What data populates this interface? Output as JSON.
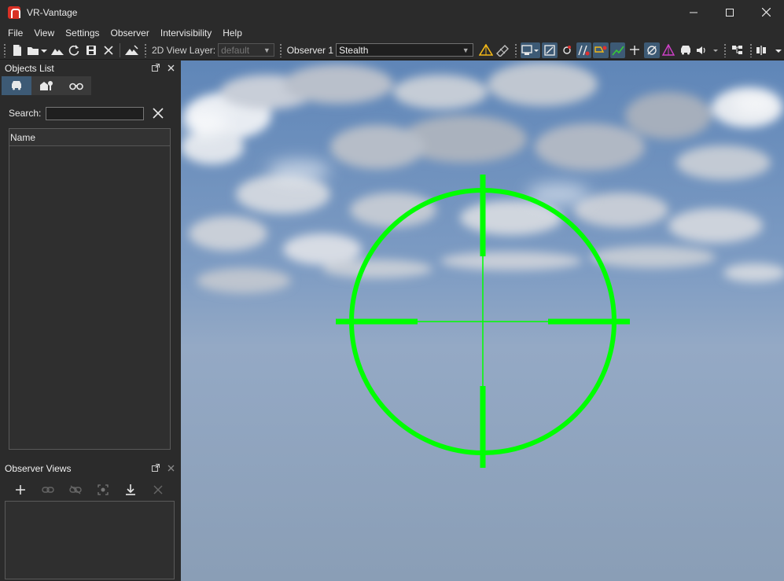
{
  "window": {
    "title": "VR-Vantage"
  },
  "menu": [
    "File",
    "View",
    "Settings",
    "Observer",
    "Intervisibility",
    "Help"
  ],
  "toolbar": {
    "view_layer_label": "2D View Layer:",
    "view_layer_value": "default",
    "observer_label": "Observer 1",
    "observer_value": "Stealth",
    "icons_file": [
      "new-file-icon",
      "open-folder-icon",
      "terrain-icon",
      "reload-icon",
      "save-icon",
      "close-icon",
      "terrain-edit-icon"
    ],
    "icons_view": [
      "measure-icon",
      "ruler-icon",
      "display-mode-icon",
      "extent-icon",
      "target-icon",
      "los-icon",
      "line-icon",
      "path-icon",
      "waypoint-icon",
      "visibility-icon",
      "cone-icon",
      "vehicle-icon",
      "sound-icon",
      "hierarchy-icon",
      "align-icon"
    ]
  },
  "objects_panel": {
    "title": "Objects List",
    "tabs": [
      "vehicle-tab-icon",
      "structures-tab-icon",
      "binoculars-tab-icon"
    ],
    "search_label": "Search:",
    "search_value": "",
    "column_name": "Name"
  },
  "observer_panel": {
    "title": "Observer Views",
    "tools": [
      "add-icon",
      "link-icon",
      "unlink-icon",
      "capture-icon",
      "download-icon",
      "delete-icon"
    ]
  },
  "colors": {
    "reticle": "#00ff00",
    "accent": "#3d5a75",
    "background": "#2b2b2b"
  }
}
